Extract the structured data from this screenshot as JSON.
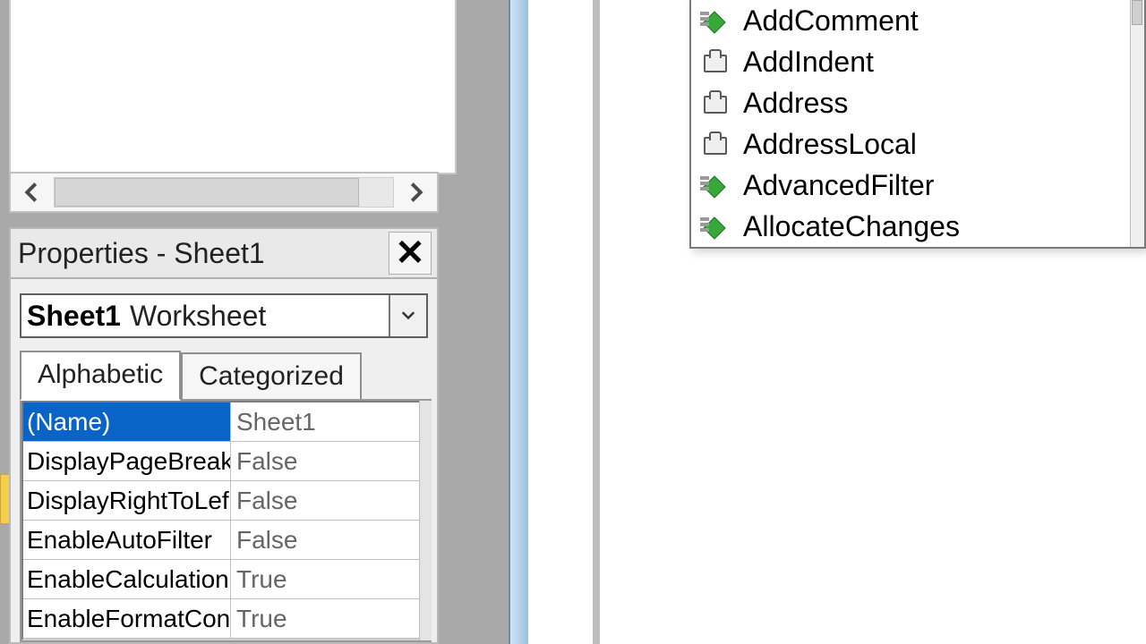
{
  "properties_panel": {
    "title": "Properties - Sheet1",
    "object_name": "Sheet1",
    "object_type": "Worksheet",
    "tabs": {
      "alphabetic": "Alphabetic",
      "categorized": "Categorized"
    },
    "rows": [
      {
        "key": "(Name)",
        "value": "Sheet1",
        "selected": true
      },
      {
        "key": "DisplayPageBreak",
        "value": "False",
        "selected": false
      },
      {
        "key": "DisplayRightToLef",
        "value": "False",
        "selected": false
      },
      {
        "key": "EnableAutoFilter",
        "value": "False",
        "selected": false
      },
      {
        "key": "EnableCalculation",
        "value": "True",
        "selected": false
      },
      {
        "key": "EnableFormatCon",
        "value": "True",
        "selected": false
      }
    ]
  },
  "intellisense": {
    "items": [
      {
        "label": "AddComment",
        "kind": "method"
      },
      {
        "label": "AddIndent",
        "kind": "property"
      },
      {
        "label": "Address",
        "kind": "property"
      },
      {
        "label": "AddressLocal",
        "kind": "property"
      },
      {
        "label": "AdvancedFilter",
        "kind": "method"
      },
      {
        "label": "AllocateChanges",
        "kind": "method"
      }
    ]
  }
}
